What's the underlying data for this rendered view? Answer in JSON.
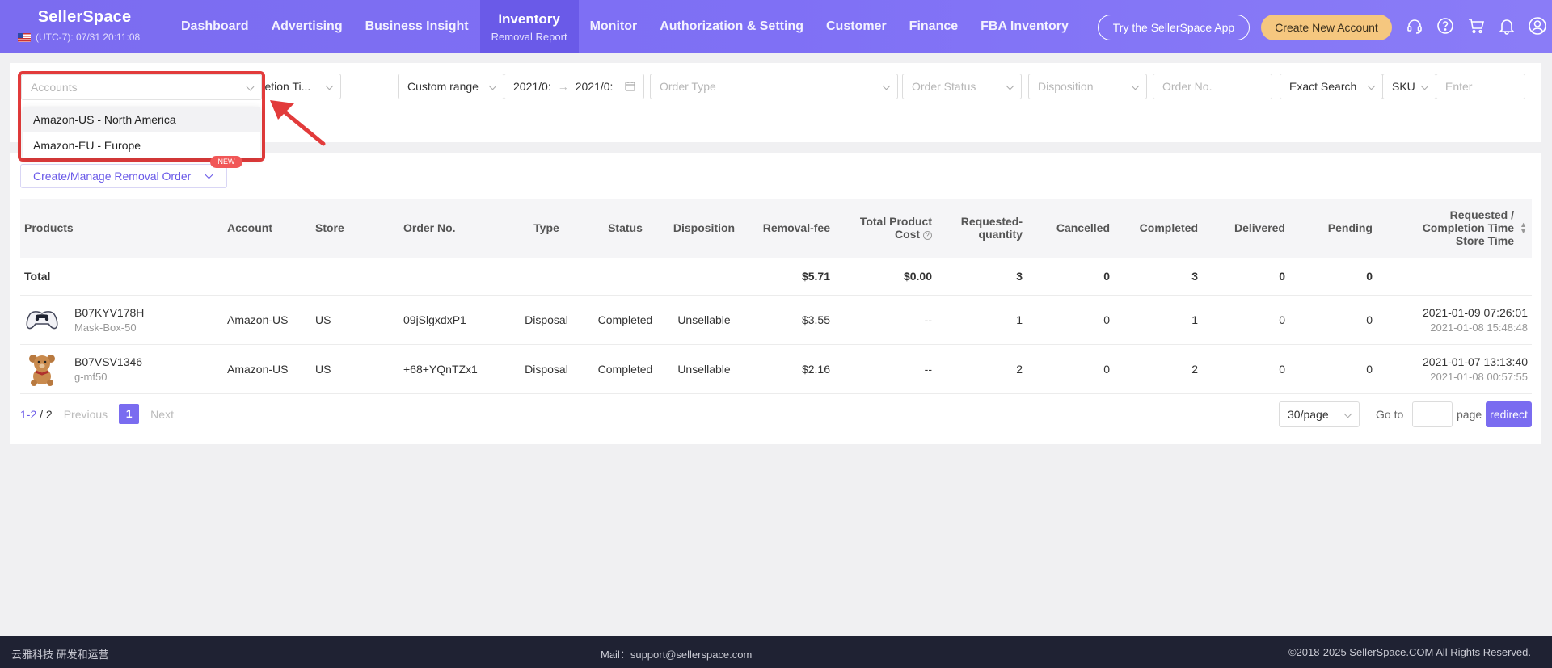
{
  "brand": {
    "name": "SellerSpace",
    "time": "(UTC-7): 07/31 20:11:08"
  },
  "nav": [
    {
      "label": "Dashboard",
      "sub": ""
    },
    {
      "label": "Advertising",
      "sub": ""
    },
    {
      "label": "Business Insight",
      "sub": ""
    },
    {
      "label": "Inventory",
      "sub": "Removal Report"
    },
    {
      "label": "Monitor",
      "sub": ""
    },
    {
      "label": "Authorization & Setting",
      "sub": ""
    },
    {
      "label": "Customer",
      "sub": ""
    },
    {
      "label": "Finance",
      "sub": ""
    },
    {
      "label": "FBA Inventory",
      "sub": ""
    }
  ],
  "header_buttons": {
    "try_app": "Try the SellerSpace App",
    "create_account": "Create New Account"
  },
  "filters": {
    "accounts_placeholder": "Accounts",
    "completion_time": "Completion Ti...",
    "custom_range": "Custom range",
    "date_from": "2021/0:",
    "date_to": "2021/0:",
    "order_type": "Order Type",
    "order_status": "Order Status",
    "disposition": "Disposition",
    "order_no": "Order No.",
    "exact_search": "Exact Search",
    "sku": "SKU",
    "enter": "Enter"
  },
  "accounts_options": [
    "Amazon-US - North America",
    "Amazon-EU - Europe"
  ],
  "removal_button": "Create/Manage Removal Order",
  "new_badge": "NEW",
  "table": {
    "headers": {
      "products": "Products",
      "account": "Account",
      "store": "Store",
      "order_no": "Order No.",
      "type": "Type",
      "status": "Status",
      "disposition": "Disposition",
      "removal_fee": "Removal-fee",
      "total_cost_1": "Total Product",
      "total_cost_2": "Cost",
      "requested_1": "Requested-",
      "requested_2": "quantity",
      "cancelled": "Cancelled",
      "completed": "Completed",
      "delivered": "Delivered",
      "pending": "Pending",
      "time_1": "Requested /",
      "time_2": "Completion Time",
      "time_3": "Store Time"
    },
    "total": {
      "label": "Total",
      "removal_fee": "$5.71",
      "total_cost": "$0.00",
      "requested": "3",
      "cancelled": "0",
      "completed": "3",
      "delivered": "0",
      "pending": "0"
    },
    "rows": [
      {
        "asin": "B07KYV178H",
        "sku": "Mask-Box-50",
        "account": "Amazon-US",
        "store": "US",
        "order_no": "09jSlgxdxP1",
        "type": "Disposal",
        "status": "Completed",
        "disposition": "Unsellable",
        "removal_fee": "$3.55",
        "total_cost": "--",
        "requested": "1",
        "cancelled": "0",
        "completed": "1",
        "delivered": "0",
        "pending": "0",
        "time": "2021-01-09 07:26:01",
        "store_time": "2021-01-08 15:48:48"
      },
      {
        "asin": "B07VSV1346",
        "sku": "g-mf50",
        "account": "Amazon-US",
        "store": "US",
        "order_no": "+68+YQnTZx1",
        "type": "Disposal",
        "status": "Completed",
        "disposition": "Unsellable",
        "removal_fee": "$2.16",
        "total_cost": "--",
        "requested": "2",
        "cancelled": "0",
        "completed": "2",
        "delivered": "0",
        "pending": "0",
        "time": "2021-01-07 13:13:40",
        "store_time": "2021-01-08 00:57:55"
      }
    ]
  },
  "pagination": {
    "range": "1-2",
    "total": "/ 2",
    "previous": "Previous",
    "page": "1",
    "next": "Next",
    "per_page": "30/page",
    "goto": "Go to",
    "page_label": "page",
    "redirect": "redirect"
  },
  "footer": {
    "left": "云雅科技 研发和运营",
    "mail": "Mail：support@sellerspace.com",
    "copyright": "©2018-2025 SellerSpace.COM All Rights Reserved."
  },
  "colors": {
    "brand": "#7b6cf0",
    "highlight": "#e23b3b",
    "accent_button": "#f5c77f"
  }
}
